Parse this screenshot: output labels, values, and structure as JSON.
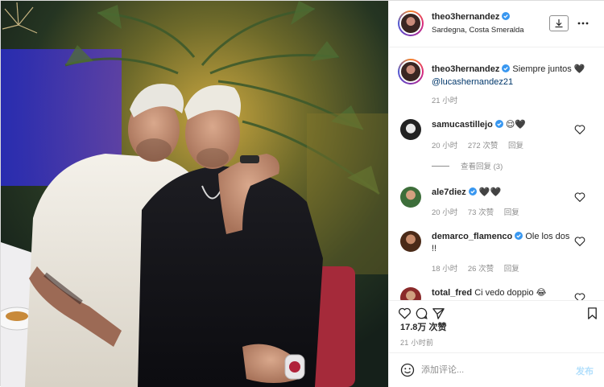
{
  "post": {
    "username": "theo3hernandez",
    "location": "Sardegna, Costa Smeralda",
    "verified": true
  },
  "caption": {
    "username": "theo3hernandez",
    "text": "Siempre juntos 🖤",
    "mention": "@lucashernandez21",
    "time": "21 小时"
  },
  "comments": [
    {
      "username": "samucastillejo",
      "text": "😌🖤",
      "time": "20 小时",
      "likes": "272 次赞",
      "reply": "回复",
      "view_replies": "查看回复 (3)",
      "verified": true
    },
    {
      "username": "ale7diez",
      "text": "🖤🖤",
      "time": "20 小时",
      "likes": "73 次赞",
      "reply": "回复",
      "verified": true
    },
    {
      "username": "demarco_flamenco",
      "text": "Ole los dos !!",
      "time": "18 小时",
      "likes": "26 次赞",
      "reply": "回复",
      "verified": true
    },
    {
      "username": "total_fred",
      "text": "Ci vedo doppio 😂",
      "verified": false
    }
  ],
  "stats": {
    "likes": "17.8万 次赞",
    "time": "21 小时前"
  },
  "add_comment": {
    "placeholder": "添加评论...",
    "post_label": "发布"
  },
  "icons": {
    "verified": "verified-badge-icon",
    "download": "download-icon",
    "more": "more-options-icon",
    "like": "heart-icon",
    "comment": "comment-icon",
    "share": "share-icon",
    "save": "bookmark-icon",
    "emoji": "emoji-icon"
  },
  "colors": {
    "verified": "#3897f0",
    "link": "#00376b",
    "muted": "#8e8e8e",
    "post_button_disabled": "#b2dffc"
  }
}
